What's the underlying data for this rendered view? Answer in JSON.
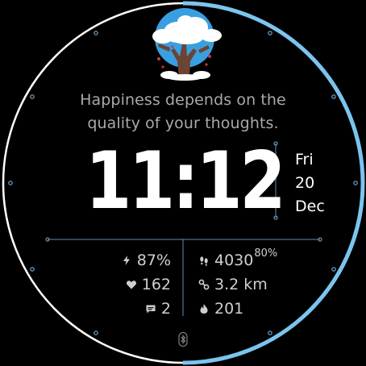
{
  "colors": {
    "background": "#000000",
    "bezel_progress": "#7cc4ee",
    "bezel_track": "#ffffff",
    "separator": "#5e8fb4",
    "quote_text": "#a9a9a9",
    "time_text": "#ffffff"
  },
  "quote": {
    "line1": "Happiness depends on the",
    "line2": "quality of your thoughts."
  },
  "clock": {
    "time": "11:12"
  },
  "date": {
    "weekday": "Fri",
    "day": "20",
    "month": "Dec"
  },
  "stats": {
    "battery": {
      "icon": "lightning-icon",
      "value": "87%"
    },
    "heart_rate": {
      "icon": "heart-icon",
      "value": "162"
    },
    "notifications": {
      "icon": "message-icon",
      "value": "2"
    },
    "steps": {
      "icon": "footsteps-icon",
      "value": "4030",
      "goal_percent": "80%"
    },
    "distance": {
      "icon": "route-icon",
      "value": "3.2 km"
    },
    "calories": {
      "icon": "flame-icon",
      "value": "201"
    }
  },
  "bezel": {
    "progress_fraction": 0.5
  },
  "status": {
    "bluetooth_icon": "bluetooth-icon"
  }
}
